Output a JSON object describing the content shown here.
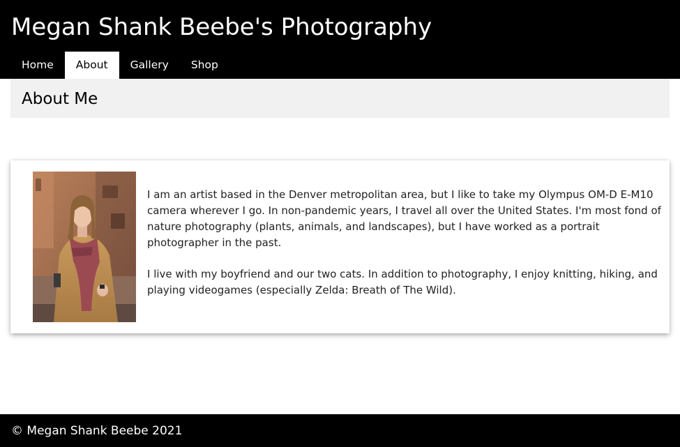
{
  "header": {
    "site_title": "Megan Shank Beebe's Photography",
    "nav": [
      {
        "label": "Home",
        "active": false
      },
      {
        "label": "About",
        "active": true
      },
      {
        "label": "Gallery",
        "active": false
      },
      {
        "label": "Shop",
        "active": false
      }
    ]
  },
  "main": {
    "page_heading": "About Me",
    "profile_photo": {
      "icon": "portrait-photo"
    },
    "bio": [
      "I am an artist based in the Denver metropolitan area, but I like to take my Olympus OM-D E-M10 camera wherever I go. In non-pandemic years, I travel all over the United States. I'm most fond of nature photography (plants, animals, and landscapes), but I have worked as a portrait photographer in the past.",
      "I live with my boyfriend and our two cats. In addition to photography, I enjoy knitting, hiking, and playing videogames (especially Zelda: Breath of The Wild)."
    ]
  },
  "footer": {
    "copyright": "© Megan Shank Beebe 2021"
  },
  "colors": {
    "header_bg": "#000000",
    "heading_bar_bg": "#f1f1f1",
    "footer_bg": "#000000",
    "active_tab_bg": "#ffffff"
  }
}
